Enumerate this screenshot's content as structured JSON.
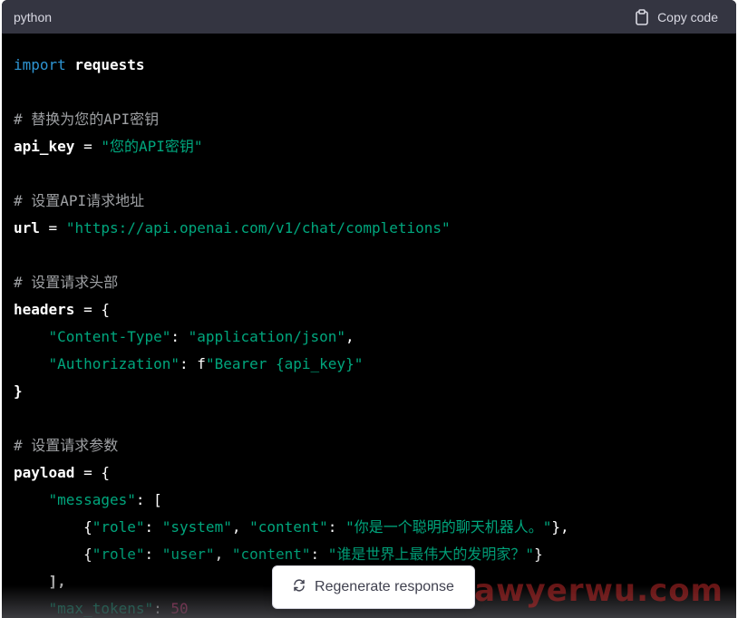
{
  "header": {
    "language": "python",
    "copy_label": "Copy code",
    "copy_icon": "clipboard-icon"
  },
  "code": {
    "l1": [
      "import",
      " requests"
    ],
    "l3": "# 替换为您的API密钥",
    "l4": [
      "api_key",
      " = ",
      "\"您的API密钥\""
    ],
    "l6": "# 设置API请求地址",
    "l7": [
      "url",
      " = ",
      "\"https://api.openai.com/v1/chat/completions\""
    ],
    "l9": "# 设置请求头部",
    "l10": [
      "headers",
      " = {"
    ],
    "l11": [
      "    ",
      "\"Content-Type\"",
      ": ",
      "\"application/json\"",
      ","
    ],
    "l12": [
      "    ",
      "\"Authorization\"",
      ": f",
      "\"Bearer {api_key}\""
    ],
    "l13": "}",
    "l15": "# 设置请求参数",
    "l16": [
      "payload",
      " = {"
    ],
    "l17": [
      "    ",
      "\"messages\"",
      ": ["
    ],
    "l18": [
      "        {",
      "\"role\"",
      ": ",
      "\"system\"",
      ", ",
      "\"content\"",
      ": ",
      "\"你是一个聪明的聊天机器人。\"",
      "},"
    ],
    "l19": [
      "        {",
      "\"role\"",
      ": ",
      "\"user\"",
      ", ",
      "\"content\"",
      ": ",
      "\"谁是世界上最伟大的发明家？\"",
      "}"
    ],
    "l20": "    ],",
    "l21": [
      "    ",
      "\"max_tokens\"",
      ": ",
      "50"
    ]
  },
  "regenerate": {
    "label": "Regenerate response",
    "icon": "refresh-icon"
  },
  "watermark": "awyerwu.com",
  "colors": {
    "header_bg": "#343541",
    "code_bg": "#000000",
    "keyword": "#2e95d3",
    "string": "#00a67d",
    "comment": "#9ea0a3",
    "number": "#df3079"
  }
}
